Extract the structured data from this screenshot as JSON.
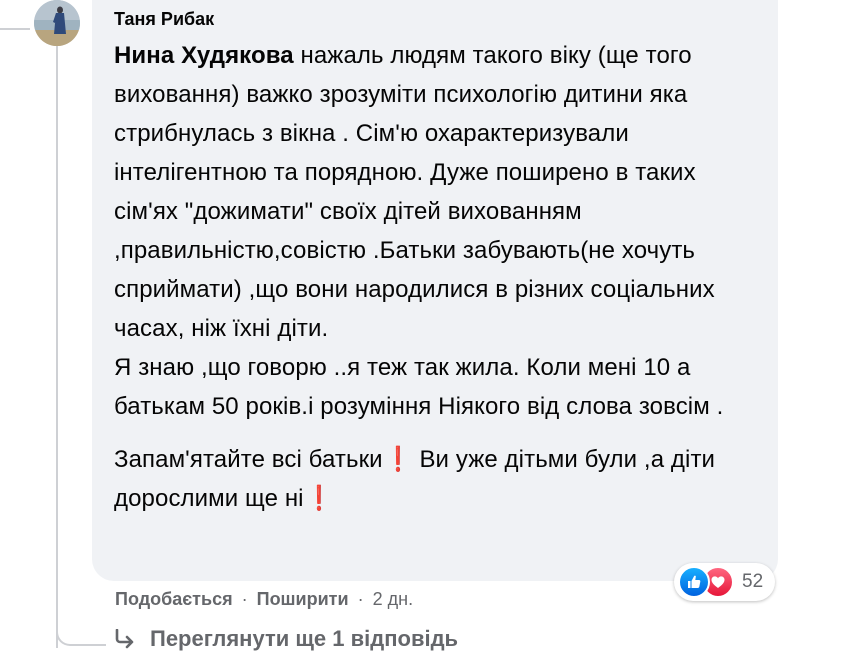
{
  "comment": {
    "author": "Таня Рибак",
    "mention": "Нина Худякова",
    "paragraph1_rest": " нажаль людям такого віку (ще того виховання) важко зрозуміти психологію дитини яка стрибнулась з вікна . Сім'ю охарактеризували інтелігентною та порядною. Дуже поширено в таких сім'ях \"дожимати\" своїх дітей вихованням ,правильністю,совістю .Батьки забувають(не хочуть сприймати) ,що вони народилися в різних соціальних часах, ніж їхні діти.",
    "paragraph2": "Я знаю ,що говорю ..я теж так жила. Коли мені 10 а батькам 50 років.і розуміння Ніякого від слова зовсім .",
    "paragraph3_a": "Запам'ятайте всі батьки",
    "paragraph3_b": " Ви уже дітьми були ,а діти дорослими ще ні",
    "exclamation_mark": "❗"
  },
  "actions": {
    "like_label": "Подобається",
    "share_label": "Поширити",
    "separator": "·",
    "time": "2 дн."
  },
  "reactions": {
    "icons": [
      "like-icon",
      "love-icon"
    ],
    "count": "52",
    "like_color": "#1877f2",
    "love_color": "#f33e58"
  },
  "replies": {
    "view_more_label": "Переглянути ще 1 відповідь"
  }
}
